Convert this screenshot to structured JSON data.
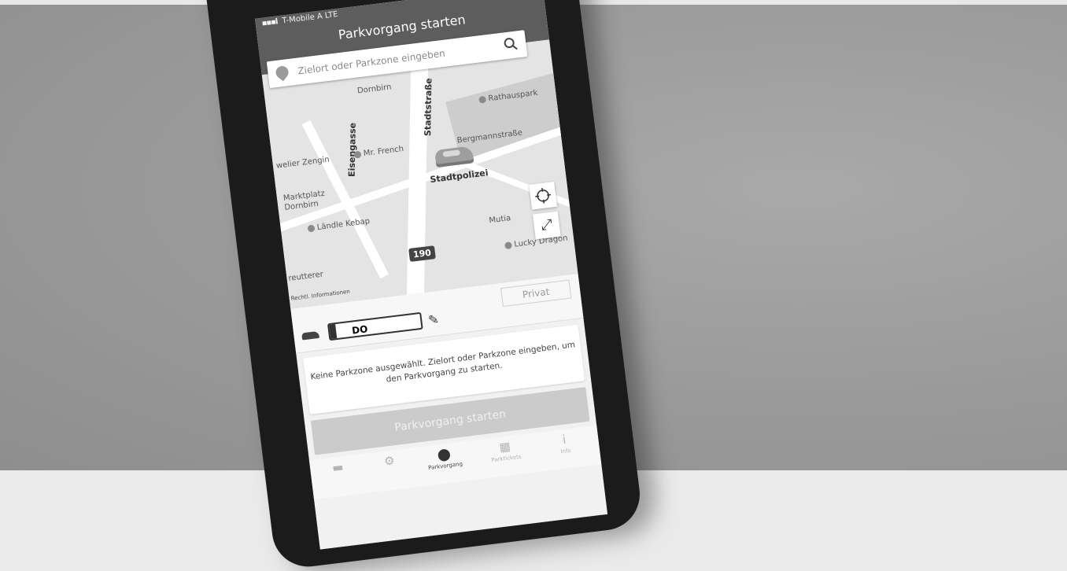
{
  "status_bar": {
    "carrier": "T-Mobile A",
    "network": "LTE"
  },
  "app": {
    "title": "Parkvorgang starten"
  },
  "search": {
    "placeholder": "Zielort oder Parkzone eingeben"
  },
  "map": {
    "labels": {
      "dornbirn": "Dornbirn",
      "stadtstrasse": "Stadtstraße",
      "rathauspark": "Rathauspark",
      "eisengasse": "Eisengasse",
      "juwelier": "welier Zengin",
      "mr_french": "Mr. French",
      "bergmann": "Bergmannstraße",
      "marktplatz": "Marktplatz Dornbirn",
      "stadtpolizei": "Stadtpolizei",
      "laendle": "Ländle Kebap",
      "mutia": "Mutia",
      "reutterer": "reutterer",
      "lucky": "Lucky Dragon"
    },
    "route_badge": "190",
    "legal": "Rechtl. Informationen"
  },
  "vehicle": {
    "privat_label": "Privat",
    "plate": "DO"
  },
  "info": {
    "message": "Keine Parkzone ausgewählt. Zielort oder Parkzone eingeben, um den Parkvorgang zu starten."
  },
  "actions": {
    "start_label": "Parkvorgang starten"
  },
  "nav": {
    "parkvorgang_label": "Parkvorgang",
    "history_label": "Parktickets",
    "info_label": "Info"
  }
}
